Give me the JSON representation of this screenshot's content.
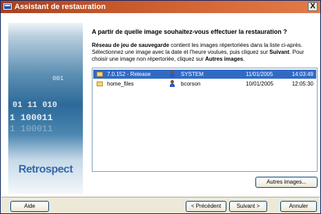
{
  "window": {
    "title": "Assistant de restauration",
    "close_label": "X"
  },
  "sidebar": {
    "brand": "Retrospect",
    "digit_lines": [
      "001",
      "01 11 010",
      "1 100011",
      "1 100011"
    ]
  },
  "main": {
    "question": "A partir de quelle image souhaitez-vous effectuer la restauration ?",
    "desc_bold1": "Réseau de jeu de sauvegarde",
    "desc_text1": " contient les images répertoriées dans la liste ci-après. Sélectionnez une image avec la date et l'heure voulues, puis cliquez sur ",
    "desc_bold2": "Suivant",
    "desc_text2": ". Pour choisir une image non répertoriée, cliquez sur ",
    "desc_bold3": "Autres images",
    "desc_text3": "."
  },
  "images": [
    {
      "name": "7.0.152 - Release",
      "user": "SYSTEM",
      "date": "11/01/2005",
      "time": "14:03:49",
      "selected": true
    },
    {
      "name": "home_files",
      "user": "bcorson",
      "date": "10/01/2005",
      "time": "12:05:30",
      "selected": false
    }
  ],
  "buttons": {
    "other_images": "Autres images...",
    "help": "Aide",
    "previous": "< Précédent",
    "next": "Suivant >",
    "cancel": "Annuler"
  },
  "colors": {
    "titlebar": "#c6572a",
    "selection": "#316ac5",
    "brand": "#3568a8"
  }
}
